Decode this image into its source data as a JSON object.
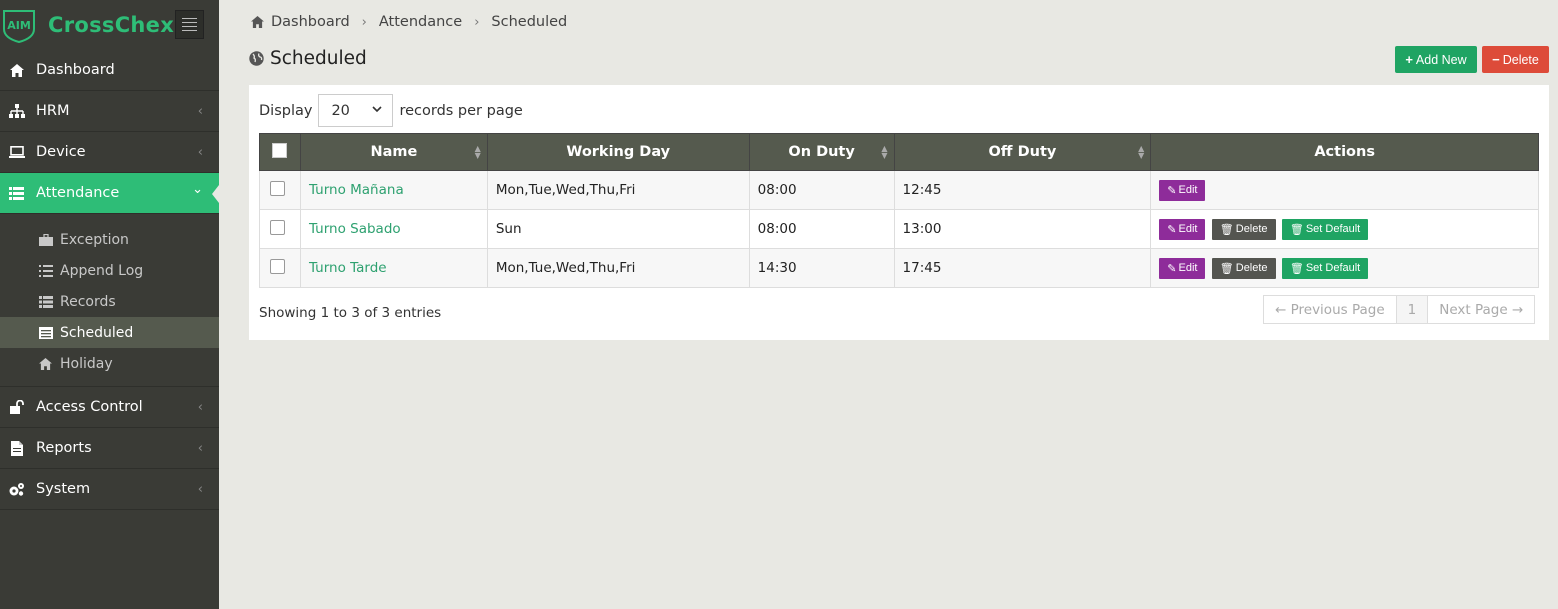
{
  "app": {
    "name": "CrossChex",
    "logo_text": "AIM"
  },
  "sidebar": {
    "items": [
      {
        "label": "Dashboard",
        "icon": "home-icon"
      },
      {
        "label": "HRM",
        "icon": "sitemap-icon"
      },
      {
        "label": "Device",
        "icon": "laptop-icon"
      },
      {
        "label": "Attendance",
        "icon": "list-icon"
      },
      {
        "label": "Access Control",
        "icon": "unlock-icon"
      },
      {
        "label": "Reports",
        "icon": "file-icon"
      },
      {
        "label": "System",
        "icon": "gears-icon"
      }
    ],
    "attendance_sub": [
      {
        "label": "Exception",
        "icon": "briefcase-icon"
      },
      {
        "label": "Append Log",
        "icon": "list-ol-icon"
      },
      {
        "label": "Records",
        "icon": "list-icon"
      },
      {
        "label": "Scheduled",
        "icon": "calendar-list-icon"
      },
      {
        "label": "Holiday",
        "icon": "home-icon"
      }
    ],
    "chevron_collapsed": "‹",
    "chevron_expanded": "⌄"
  },
  "breadcrumb": [
    "Dashboard",
    "Attendance",
    "Scheduled"
  ],
  "page": {
    "title": "Scheduled",
    "add_label": "Add New",
    "delete_label": "Delete"
  },
  "display": {
    "prefix": "Display",
    "value": "20",
    "suffix": "records per page"
  },
  "table": {
    "headers": [
      "Name",
      "Working Day",
      "On Duty",
      "Off Duty",
      "Actions"
    ],
    "rows": [
      {
        "name": "Turno Mañana",
        "days": "Mon,Tue,Wed,Thu,Fri",
        "on": "08:00",
        "off": "12:45",
        "actions": [
          "Edit"
        ]
      },
      {
        "name": "Turno Sabado",
        "days": "Sun",
        "on": "08:00",
        "off": "13:00",
        "actions": [
          "Edit",
          "Delete",
          "Set Default"
        ]
      },
      {
        "name": "Turno Tarde",
        "days": "Mon,Tue,Wed,Thu,Fri",
        "on": "14:30",
        "off": "17:45",
        "actions": [
          "Edit",
          "Delete",
          "Set Default"
        ]
      }
    ]
  },
  "footer": {
    "showing": "Showing 1 to 3 of 3 entries",
    "prev": "← Previous Page",
    "page": "1",
    "next": "Next Page →"
  },
  "colors": {
    "accent": "#2ebd77",
    "sidebar": "#3a3b36",
    "edit": "#8e2c9a",
    "danger": "#dd4b39"
  }
}
